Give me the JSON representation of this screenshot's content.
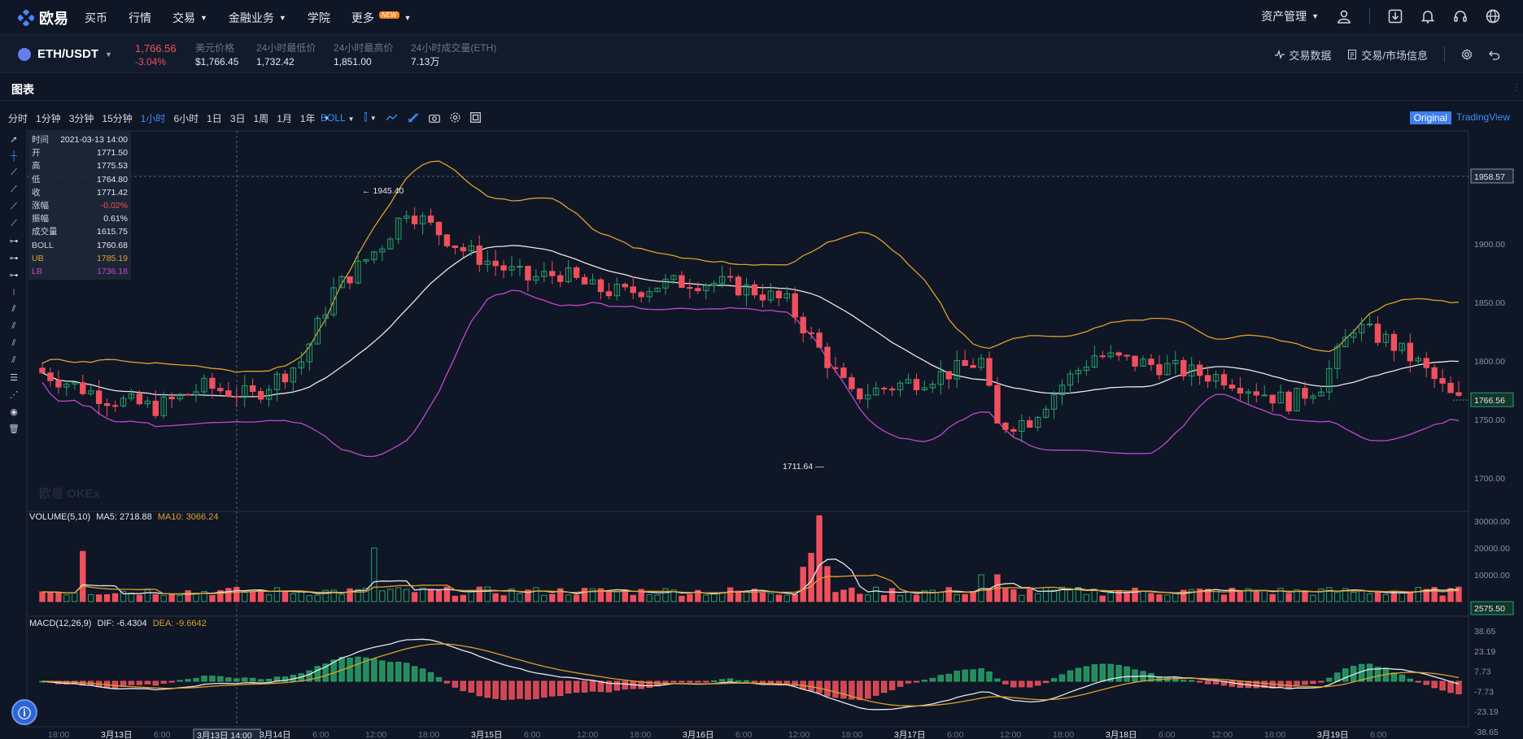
{
  "nav": {
    "logo": "欧易",
    "items": [
      "买币",
      "行情",
      "交易",
      "金融业务",
      "学院",
      "更多"
    ],
    "new_badge": "NEW",
    "asset": "资产管理"
  },
  "ticker": {
    "pair": "ETH/USDT",
    "price": "1,766.56",
    "change": "-3.04%",
    "usd_label": "美元价格",
    "usd_value": "$1,766.45",
    "low_label": "24小时最低价",
    "low_value": "1,732.42",
    "high_label": "24小时最高价",
    "high_value": "1,851.00",
    "vol_label": "24小时成交量(ETH)",
    "vol_value": "7.13万",
    "trade_data": "交易数据",
    "market_info": "交易/市场信息"
  },
  "panel": {
    "title": "图表",
    "intervals": [
      "分时",
      "1分钟",
      "3分钟",
      "15分钟",
      "1小时",
      "6小时",
      "1日",
      "3日",
      "1周",
      "1月",
      "1年"
    ],
    "active_interval": "1小时",
    "indicator": "BOLL",
    "original": "Original",
    "tradingview": "TradingView"
  },
  "ohlc_box": {
    "time_label": "时间",
    "time": "2021-03-13 14:00",
    "open_label": "开",
    "open": "1771.50",
    "high_label": "高",
    "high": "1775.53",
    "low_label": "低",
    "low": "1764.80",
    "close_label": "收",
    "close": "1771.42",
    "chg_label": "涨幅",
    "chg": "-0.02%",
    "amp_label": "振幅",
    "amp": "0.61%",
    "vol_label": "成交量",
    "vol": "1615.75",
    "boll_label": "BOLL",
    "boll": "1760.68",
    "ub_label": "UB",
    "ub": "1785.19",
    "lb_label": "LB",
    "lb": "1736.18"
  },
  "price_axis": [
    "1900.00",
    "1850.00",
    "1800.00",
    "1750.00",
    "1700.00"
  ],
  "price_marks": {
    "crosshair": "1958.57",
    "last": "1766.56",
    "high_mark": "1945.40",
    "low_mark": "1711.64"
  },
  "volume": {
    "header": "VOLUME(5,10)",
    "ma5": "MA5: 2718.88",
    "ma10": "MA10: 3066.24",
    "axis": [
      "30000.00",
      "20000.00",
      "10000.00"
    ],
    "last": "2575.50"
  },
  "macd": {
    "header": "MACD(12,26,9)",
    "dif": "DIF: -6.4304",
    "dea": "DEA: -9.6642",
    "axis": [
      "38.65",
      "23.19",
      "7.73",
      "-7.73",
      "-23.19",
      "-38.65"
    ]
  },
  "time_axis": [
    "18:00",
    "3月13日",
    "6:00",
    "3月13日 14:00",
    "3月14日",
    "6:00",
    "12:00",
    "18:00",
    "3月15日",
    "6:00",
    "12:00",
    "18:00",
    "3月16日",
    "6:00",
    "12:00",
    "18:00",
    "3月17日",
    "6:00",
    "12:00",
    "18:00",
    "3月18日",
    "6:00",
    "12:00",
    "18:00",
    "3月19日",
    "6:00"
  ],
  "watermark": "欧易 OKEx",
  "colors": {
    "up": "#26a269",
    "down": "#f0505c",
    "ub": "#e0a02a",
    "lb": "#c04ac8",
    "mid": "#e8e8e8",
    "accent": "#3d8ef8"
  }
}
